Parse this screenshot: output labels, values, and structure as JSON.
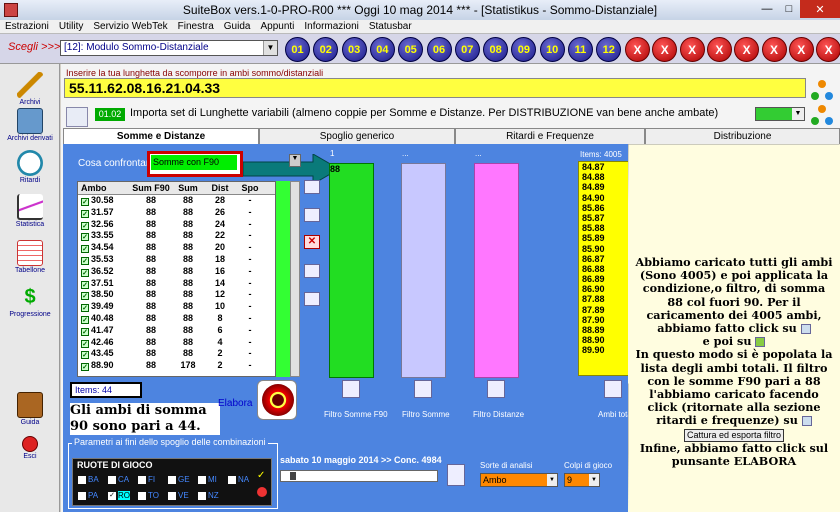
{
  "window": {
    "title": "SuiteBox vers.1-0-PRO-R00  ***  Oggi 10 mag 2014  ***  - [Statistikus - Sommo-Distanziale]"
  },
  "menu": [
    "Estrazioni",
    "Utility",
    "Servizio WebTek",
    "Finestra",
    "Guida",
    "Appunti",
    "Informazioni",
    "Statusbar"
  ],
  "toolbar": {
    "scegli": "Scegli >>>",
    "module": "[12]: Modulo Sommo-Distanziale",
    "numbers": [
      "01",
      "02",
      "03",
      "04",
      "05",
      "06",
      "07",
      "08",
      "09",
      "10",
      "11",
      "12"
    ],
    "x_label": "X"
  },
  "sidebar": [
    "Archivi",
    "Archivi derivati",
    "Ritardi",
    "Statistica",
    "Tabellone",
    "Progressione",
    "Guida",
    "Esci"
  ],
  "input": {
    "label": "Inserire la tua lunghetta da scomporre in ambi sommo/distanziali",
    "value": "55.11.62.08.16.21.04.33"
  },
  "import": {
    "code": "01.02",
    "label": "Importa set di Lunghette variabili (almeno coppie per Somme e Distanze. Per DISTRIBUZIONE van bene anche ambate)"
  },
  "tabs": [
    "Somme e Distanze",
    "Spoglio generico",
    "Ritardi e Frequenze",
    "Distribuzione"
  ],
  "cosa": {
    "label": "Cosa confrontare",
    "value": "Somme con F90"
  },
  "table": {
    "headers": [
      "Ambo",
      "Sum F90",
      "Sum",
      "Dist",
      "Spo"
    ],
    "rows": [
      [
        "30.58",
        "88",
        "88",
        "28",
        "-"
      ],
      [
        "31.57",
        "88",
        "88",
        "26",
        "-"
      ],
      [
        "32.56",
        "88",
        "88",
        "24",
        "-"
      ],
      [
        "33.55",
        "88",
        "88",
        "22",
        "-"
      ],
      [
        "34.54",
        "88",
        "88",
        "20",
        "-"
      ],
      [
        "35.53",
        "88",
        "88",
        "18",
        "-"
      ],
      [
        "36.52",
        "88",
        "88",
        "16",
        "-"
      ],
      [
        "37.51",
        "88",
        "88",
        "14",
        "-"
      ],
      [
        "38.50",
        "88",
        "88",
        "12",
        "-"
      ],
      [
        "39.49",
        "88",
        "88",
        "10",
        "-"
      ],
      [
        "40.48",
        "88",
        "88",
        "8",
        "-"
      ],
      [
        "41.47",
        "88",
        "88",
        "6",
        "-"
      ],
      [
        "42.46",
        "88",
        "88",
        "4",
        "-"
      ],
      [
        "43.45",
        "88",
        "88",
        "2",
        "-"
      ],
      [
        "88.90",
        "88",
        "178",
        "2",
        "-"
      ]
    ]
  },
  "bars": {
    "bar1_label": "1",
    "bar1_value": "88",
    "bar2_label": "...",
    "bar3_label": "..."
  },
  "items": {
    "label": "Items: 4005",
    "values": [
      "84.87",
      "84.88",
      "84.89",
      "84.90",
      "85.86",
      "85.87",
      "85.88",
      "85.89",
      "85.90",
      "86.87",
      "86.88",
      "86.89",
      "86.90",
      "87.88",
      "87.89",
      "87.90",
      "88.89",
      "88.90",
      "89.90"
    ]
  },
  "bottom_labels": [
    "Filtro Somme F90",
    "Filtro Somme",
    "Filtro Distanze",
    "Ambi totali"
  ],
  "items44": "Items: 44",
  "ambi_note": "Gli ambi di somma 90 sono pari a 44.",
  "elabora": "Elabora",
  "params": {
    "legend": "Parametri ai fini dello spoglio delle combinazioni",
    "ruote_title": "RUOTE DI GIOCO",
    "ruote": [
      "BA",
      "CA",
      "FI",
      "GE",
      "MI",
      "NA",
      "PA",
      "RO",
      "TO",
      "VE",
      "NZ"
    ],
    "date": "sabato 10 maggio 2014 >> Conc. 4984",
    "sorte_label": "Sorte di analisi",
    "sorte": "Ambo",
    "colpi_label": "Colpi di gioco",
    "colpi": "9"
  },
  "callout": {
    "p1": "Abbiamo caricato  tutti gli ambi (Sono 4005) e poi applicata la condizione,o filtro, di somma 88 col fuori 90. Per il caricamento dei 4005 ambi, abbiamo fatto click su",
    "p2": "e poi su",
    "p3": "In questo modo si è popolata la lista degli ambi totali. Il filtro con le somme F90 pari a 88 l'abbiamo caricato facendo click (ritornate alla sezione ritardi e frequenze) su",
    "btn": "Cattura ed esporta filtro",
    "p4": "Infine, abbiamo fatto click sul punsante ELABORA"
  },
  "colors": {
    "panel": "#4d84e0",
    "input_yellow": "#ffff40",
    "bar_green": "#22dd22",
    "bar_lilac": "#c8c8ff",
    "bar_pink": "#ff77ff",
    "callout": "#fffde0"
  }
}
